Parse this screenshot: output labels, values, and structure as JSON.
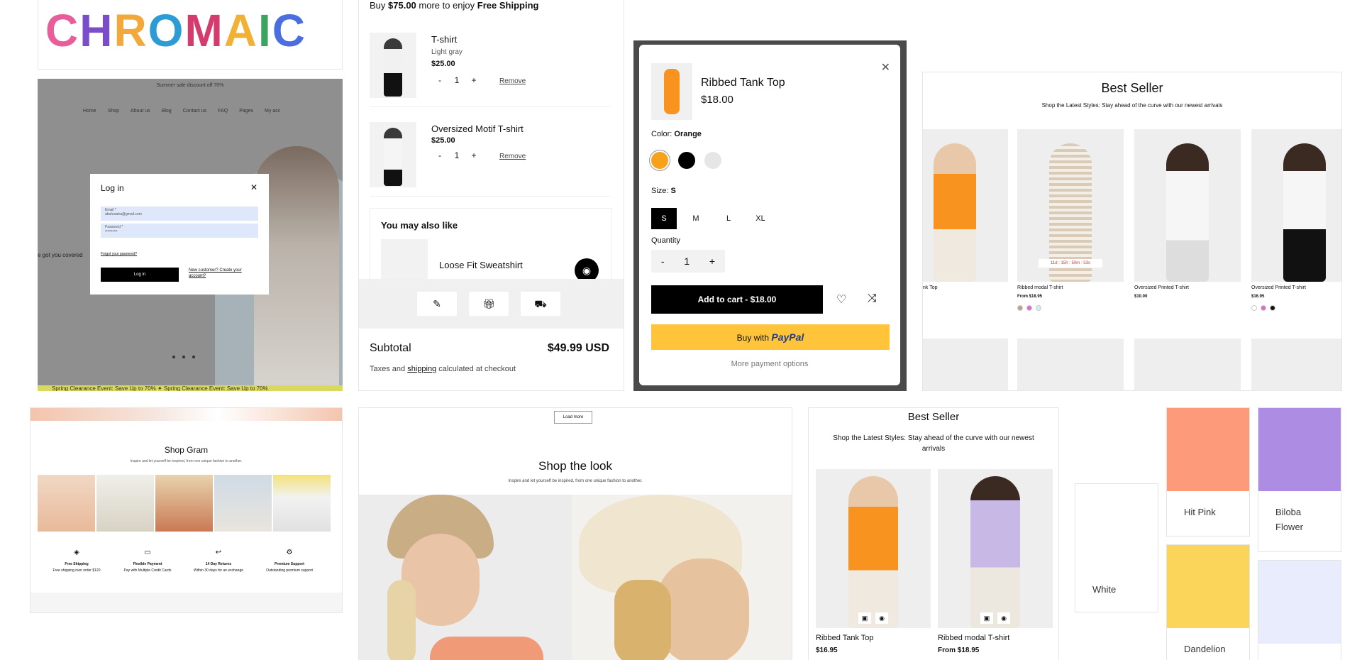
{
  "logo": {
    "letters": [
      "C",
      "H",
      "R",
      "O",
      "M",
      "A",
      "I",
      "C"
    ],
    "colors": [
      "#e85d9a",
      "#7b4ec9",
      "#f2a93b",
      "#2d9bd6",
      "#d63b6e",
      "#f2b134",
      "#3aa55d",
      "#4a6ee0"
    ]
  },
  "login": {
    "promo": "Summer sale discount off 70%",
    "nav": [
      "Home",
      "Shop",
      "About us",
      "Blog",
      "Contact us",
      "FAQ",
      "Pages",
      "My acc"
    ],
    "tagline": "e got you covered",
    "modal_title": "Log in",
    "email_label": "Email *",
    "email_value": "abuhuraira@gmail.com",
    "password_label": "Password *",
    "password_value": "••••••••••",
    "forgot": "Forgot your password?",
    "login_button": "Log in",
    "create_account": "New customer? Create your account?",
    "marquee": "Spring Clearance Event: Save Up to 70%   ✦ Spring Clearance Event: Save Up to 70%"
  },
  "cart": {
    "shipping_prefix": "Buy ",
    "shipping_amount": "$75.00",
    "shipping_mid": " more to enjoy ",
    "shipping_bold": "Free Shipping",
    "items": [
      {
        "name": "T-shirt",
        "variant": "Light gray",
        "price": "$25.00",
        "qty": "1"
      },
      {
        "name": "Oversized Motif T-shirt",
        "variant": "",
        "price": "$25.00",
        "qty": "1"
      }
    ],
    "qty_minus": "-",
    "qty_plus": "+",
    "remove_label": "Remove",
    "also_title": "You may also like",
    "also_item": "Loose Fit Sweatshirt",
    "tools": [
      "note-icon",
      "gift-icon",
      "truck-icon"
    ],
    "subtotal_label": "Subtotal",
    "subtotal_value": "$49.99 USD",
    "taxes_prefix": "Taxes and ",
    "taxes_link": "shipping",
    "taxes_suffix": " calculated at checkout"
  },
  "quickview": {
    "title": "Ribbed Tank Top",
    "price": "$18.00",
    "color_label": "Color:",
    "color_value": "Orange",
    "swatches": [
      "#f7a21a",
      "#000000",
      "#e6e6e6"
    ],
    "size_label": "Size:",
    "size_value": "S",
    "sizes": [
      "S",
      "M",
      "L",
      "XL"
    ],
    "quantity_label": "Quantity",
    "quantity": "1",
    "add_to_cart": "Add to cart - $18.00",
    "paypal_prefix": "Buy with",
    "paypal_brand": "PayPal",
    "more_options": "More payment options"
  },
  "bestseller": {
    "title": "Best Seller",
    "subtitle": "Shop the Latest Styles: Stay ahead of the curve with our newest arrivals",
    "products": [
      {
        "name": "nk Top",
        "price": "",
        "color": "#f7931e"
      },
      {
        "name": "Ribbed modal T-shirt",
        "price": "From $18.95",
        "color": "#d9cbb8"
      },
      {
        "name": "Oversized Printed T-shirt",
        "price": "$10.00",
        "color": "#f5f5f5"
      },
      {
        "name": "Oversized Printed T-shirt",
        "price": "$16.95",
        "color": "#f5f5f5"
      }
    ],
    "countdown": "11d : 15h : 50m : 53s"
  },
  "gram": {
    "title": "Shop Gram",
    "subtitle": "Inspire and let yourself be inspired, from one unique fashion to another.",
    "features": [
      {
        "title": "Free Shipping",
        "text": "Free shipping over order $120"
      },
      {
        "title": "Flexible Payment",
        "text": "Pay with Multiple Credit Cards"
      },
      {
        "title": "14 Day Returns",
        "text": "Within 30 days for an exchange"
      },
      {
        "title": "Premium Support",
        "text": "Outstanding premium support"
      }
    ]
  },
  "look": {
    "load_more": "Load more",
    "title": "Shop the look",
    "subtitle": "Inspire and let yourself be inspired, from one unique fashion to another."
  },
  "bestseller2": {
    "title": "Best Seller",
    "subtitle": "Shop the Latest Styles: Stay ahead of the curve with our newest arrivals",
    "products": [
      {
        "name": "Ribbed Tank Top",
        "price": "$16.95",
        "color": "#f7931e"
      },
      {
        "name": "Ribbed modal T-shirt",
        "price": "From $18.95",
        "color": "#c8b8e6"
      }
    ]
  },
  "tiles": [
    {
      "label": "White",
      "color": "#ffffff"
    },
    {
      "label": "Hit Pink",
      "color": "#fd9a79"
    },
    {
      "label": "Biloba Flower",
      "color": "#ad8ce3"
    },
    {
      "label": "Dandelion",
      "color": "#fbd45a"
    },
    {
      "label": "",
      "color": "#e8ecfc"
    }
  ]
}
